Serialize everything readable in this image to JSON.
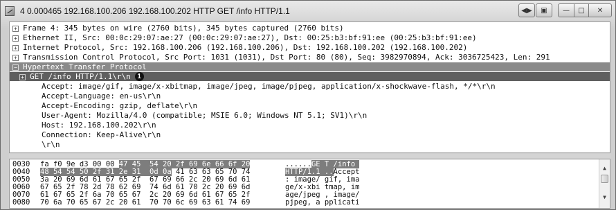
{
  "window": {
    "title": "4 0.000465 192.168.100.206 192.168.100.202 HTTP GET /info HTTP/1.1"
  },
  "tree": {
    "frame": "Frame 4: 345 bytes on wire (2760 bits), 345 bytes captured (2760 bits)",
    "ethernet": "Ethernet II, Src: 00:0c:29:07:ae:27 (00:0c:29:07:ae:27), Dst: 00:25:b3:bf:91:ee (00:25:b3:bf:91:ee)",
    "ip": "Internet Protocol, Src: 192.168.100.206 (192.168.100.206), Dst: 192.168.100.202 (192.168.100.202)",
    "tcp": "Transmission Control Protocol, Src Port: 1031 (1031), Dst Port: 80 (80), Seq: 3982970894, Ack: 3036725423, Len: 291",
    "http": "Hypertext Transfer Protocol",
    "get_line": "GET /info HTTP/1.1\\r\\n",
    "callout": "1",
    "headers": [
      "Accept: image/gif, image/x-xbitmap, image/jpeg, image/pjpeg, application/x-shockwave-flash, */*\\r\\n",
      "Accept-Language: en-us\\r\\n",
      "Accept-Encoding: gzip, deflate\\r\\n",
      "User-Agent: Mozilla/4.0 (compatible; MSIE 6.0; Windows NT 5.1; SV1)\\r\\n",
      "Host: 192.168.100.202\\r\\n",
      "Connection: Keep-Alive\\r\\n",
      "\\r\\n"
    ],
    "toggle_collapsed": "+",
    "toggle_expanded": "−"
  },
  "hex": {
    "rows": [
      {
        "offset": "0030",
        "plain": "fa f0 9e d3 00 00 ",
        "hl": "47 45  54 20 2f 69 6e 66 6f 20",
        "after": "",
        "ascii_plain": "......",
        "ascii_hl": "GE T /info ",
        "ascii_after": ""
      },
      {
        "offset": "0040",
        "plain": "",
        "hl": "48 54 54 50 2f 31 2e 31  0d 0a",
        "after": " 41 63 63 65 70 74",
        "ascii_plain": "",
        "ascii_hl": "HTTP/1.1 ..",
        "ascii_after": "Accept"
      },
      {
        "offset": "0050",
        "plain": "3a 20 69 6d 61 67 65 2f  67 69 66 2c 20 69 6d 61",
        "hl": "",
        "after": "",
        "ascii_plain": ": image/ gif, ima",
        "ascii_hl": "",
        "ascii_after": ""
      },
      {
        "offset": "0060",
        "plain": "67 65 2f 78 2d 78 62 69  74 6d 61 70 2c 20 69 6d",
        "hl": "",
        "after": "",
        "ascii_plain": "ge/x-xbi tmap, im",
        "ascii_hl": "",
        "ascii_after": ""
      },
      {
        "offset": "0070",
        "plain": "61 67 65 2f 6a 70 65 67  2c 20 69 6d 61 67 65 2f",
        "hl": "",
        "after": "",
        "ascii_plain": "age/jpeg , image/",
        "ascii_hl": "",
        "ascii_after": ""
      },
      {
        "offset": "0080",
        "plain": "70 6a 70 65 67 2c 20 61  70 70 6c 69 63 61 74 69",
        "hl": "",
        "after": "",
        "ascii_plain": "pjpeg, a pplicati",
        "ascii_hl": "",
        "ascii_after": ""
      }
    ]
  }
}
